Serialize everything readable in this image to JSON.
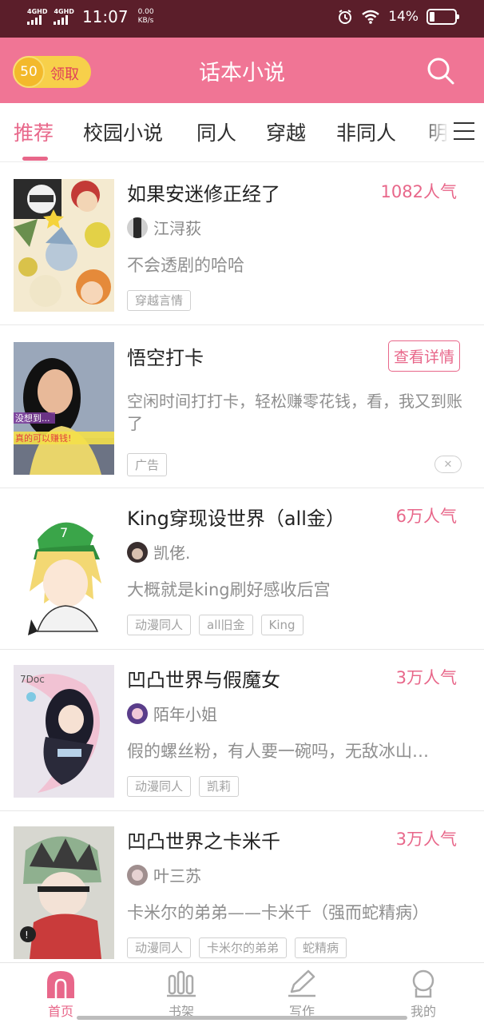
{
  "status_bar": {
    "sim1": "4GHD",
    "sim2": "4GHD",
    "time": "11:07",
    "net_speed_value": "0.00",
    "net_speed_unit": "KB/s",
    "battery": "14%"
  },
  "header": {
    "coins": "50",
    "claim_label": "领取",
    "title": "话本小说"
  },
  "tabs": [
    "推荐",
    "校园小说",
    "同人",
    "穿越",
    "非同人",
    "明"
  ],
  "books": [
    {
      "title": "如果安迷修正经了",
      "popularity": "1082人气",
      "author": "江浔荻",
      "description": "不会透剧的哈哈",
      "tags": [
        "穿越言情"
      ]
    },
    {
      "title": "King穿现设世界（all金）",
      "popularity": "6万人气",
      "author": "凯佬.",
      "description": "大概就是king刷好感收后宫",
      "tags": [
        "动漫同人",
        "all旧金",
        "King"
      ]
    },
    {
      "title": "凹凸世界与假魔女",
      "popularity": "3万人气",
      "author": "陌年小姐",
      "description": "假的螺丝粉，有人要一碗吗，无敌冰山…",
      "tags": [
        "动漫同人",
        "凯莉"
      ]
    },
    {
      "title": "凹凸世界之卡米千",
      "popularity": "3万人气",
      "author": "叶三苏",
      "description": "卡米尔的弟弟——卡米千（强而蛇精病）",
      "tags": [
        "动漫同人",
        "卡米尔的弟弟",
        "蛇精病"
      ]
    }
  ],
  "ad": {
    "title": "悟空打卡",
    "button": "查看详情",
    "description": "空闲时间打打卡，轻松赚零花钱，看，我又到账了",
    "badge": "广告",
    "image_caption_1": "没想到...",
    "image_caption_2": "真的可以赚钱!"
  },
  "bottom_nav": [
    "首页",
    "书架",
    "写作",
    "我的"
  ],
  "colors": {
    "brand": "#f07595",
    "accent": "#e8678a",
    "status_bar": "#5b1e2a"
  }
}
